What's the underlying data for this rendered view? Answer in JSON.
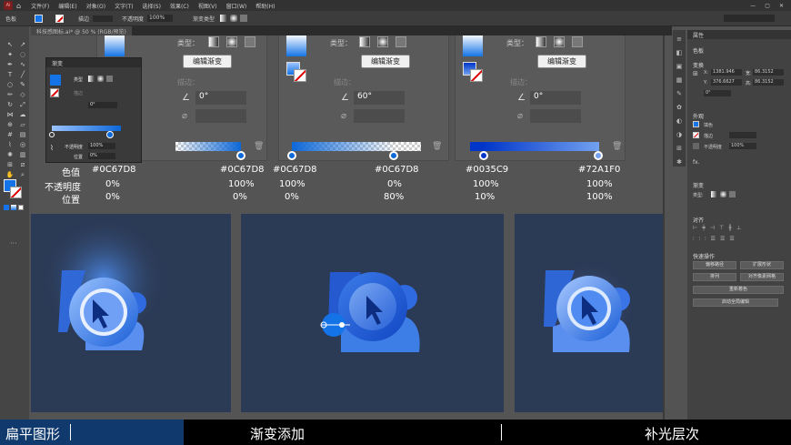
{
  "menu": {
    "items": [
      "文件(F)",
      "编辑(E)",
      "对象(O)",
      "文字(T)",
      "选择(S)",
      "效果(C)",
      "视图(V)",
      "窗口(W)",
      "帮助(H)"
    ]
  },
  "control": {
    "selection_label": "色板",
    "stroke_label": "描边",
    "opacity_label": "不透明度",
    "opacity_value": "100%",
    "gradient_type_label": "渐变类型"
  },
  "document": {
    "tab_title": "科技感图标.ai* @ 50 % (RGB/预览)"
  },
  "float_panel": {
    "title": "渐变",
    "type_label": "类型",
    "stroke_label": "描边",
    "angle_value": "0°",
    "opacity_label": "不透明度",
    "opacity_value": "100%",
    "position_label": "位置",
    "position_value": "0%"
  },
  "grad_panels": [
    {
      "type_label": "类型：",
      "edit_btn": "编辑渐变",
      "stroke_label": "描边：",
      "angle_value": "0°"
    },
    {
      "type_label": "类型：",
      "edit_btn": "编辑渐变",
      "stroke_label": "描边：",
      "angle_value": "60°"
    },
    {
      "type_label": "类型：",
      "edit_btn": "编辑渐变",
      "stroke_label": "描边：",
      "angle_value": "0°"
    }
  ],
  "row_labels": {
    "color": "色值",
    "opacity": "不透明度",
    "position": "位置"
  },
  "columns": [
    {
      "color": "#0C67D8",
      "opacity": "0%",
      "position": "0%"
    },
    {
      "color": "#0C67D8",
      "opacity": "100%",
      "position": "0%"
    },
    {
      "color": "#0C67D8",
      "opacity": "100%",
      "position": "0%"
    },
    {
      "color": "#0C67D8",
      "opacity": "0%",
      "position": "80%"
    },
    {
      "color": "#0035C9",
      "opacity": "100%",
      "position": "10%"
    },
    {
      "color": "#72A1F0",
      "opacity": "100%",
      "position": "100%"
    }
  ],
  "right_panel": {
    "properties_title": "属性",
    "swatch_label": "色板",
    "transform_title": "变换",
    "x_label": "X:",
    "x_value": "1381.946",
    "y_label": "Y:",
    "y_value": "376.6627",
    "w_label": "宽:",
    "w_value": "86.3152",
    "h_label": "高:",
    "h_value": "86.3152",
    "angle_value": "0°",
    "appearance_title": "外观",
    "fill_label": "填色",
    "stroke_label": "描边",
    "opacity_label": "不透明度",
    "opacity_value": "100%",
    "fx_label": "fx.",
    "gradient_title": "渐变",
    "type_label": "类型:",
    "align_title": "对齐",
    "quick_title": "快速操作",
    "quick_buttons": [
      "偏移路径",
      "扩展形状",
      "排列",
      "对齐像素网格",
      "重新着色",
      "启动全局编辑"
    ]
  },
  "subtitles": {
    "left": "扁平图形",
    "center": "渐变添加",
    "right": "补光层次"
  },
  "colors": {
    "accent": "#1473E6",
    "gradient_blue": "#0C67D8",
    "gradient_dark": "#0035C9",
    "gradient_light": "#72A1F0",
    "card_bg": "#2B3A55",
    "icon_shape": "#3C7BE8"
  }
}
